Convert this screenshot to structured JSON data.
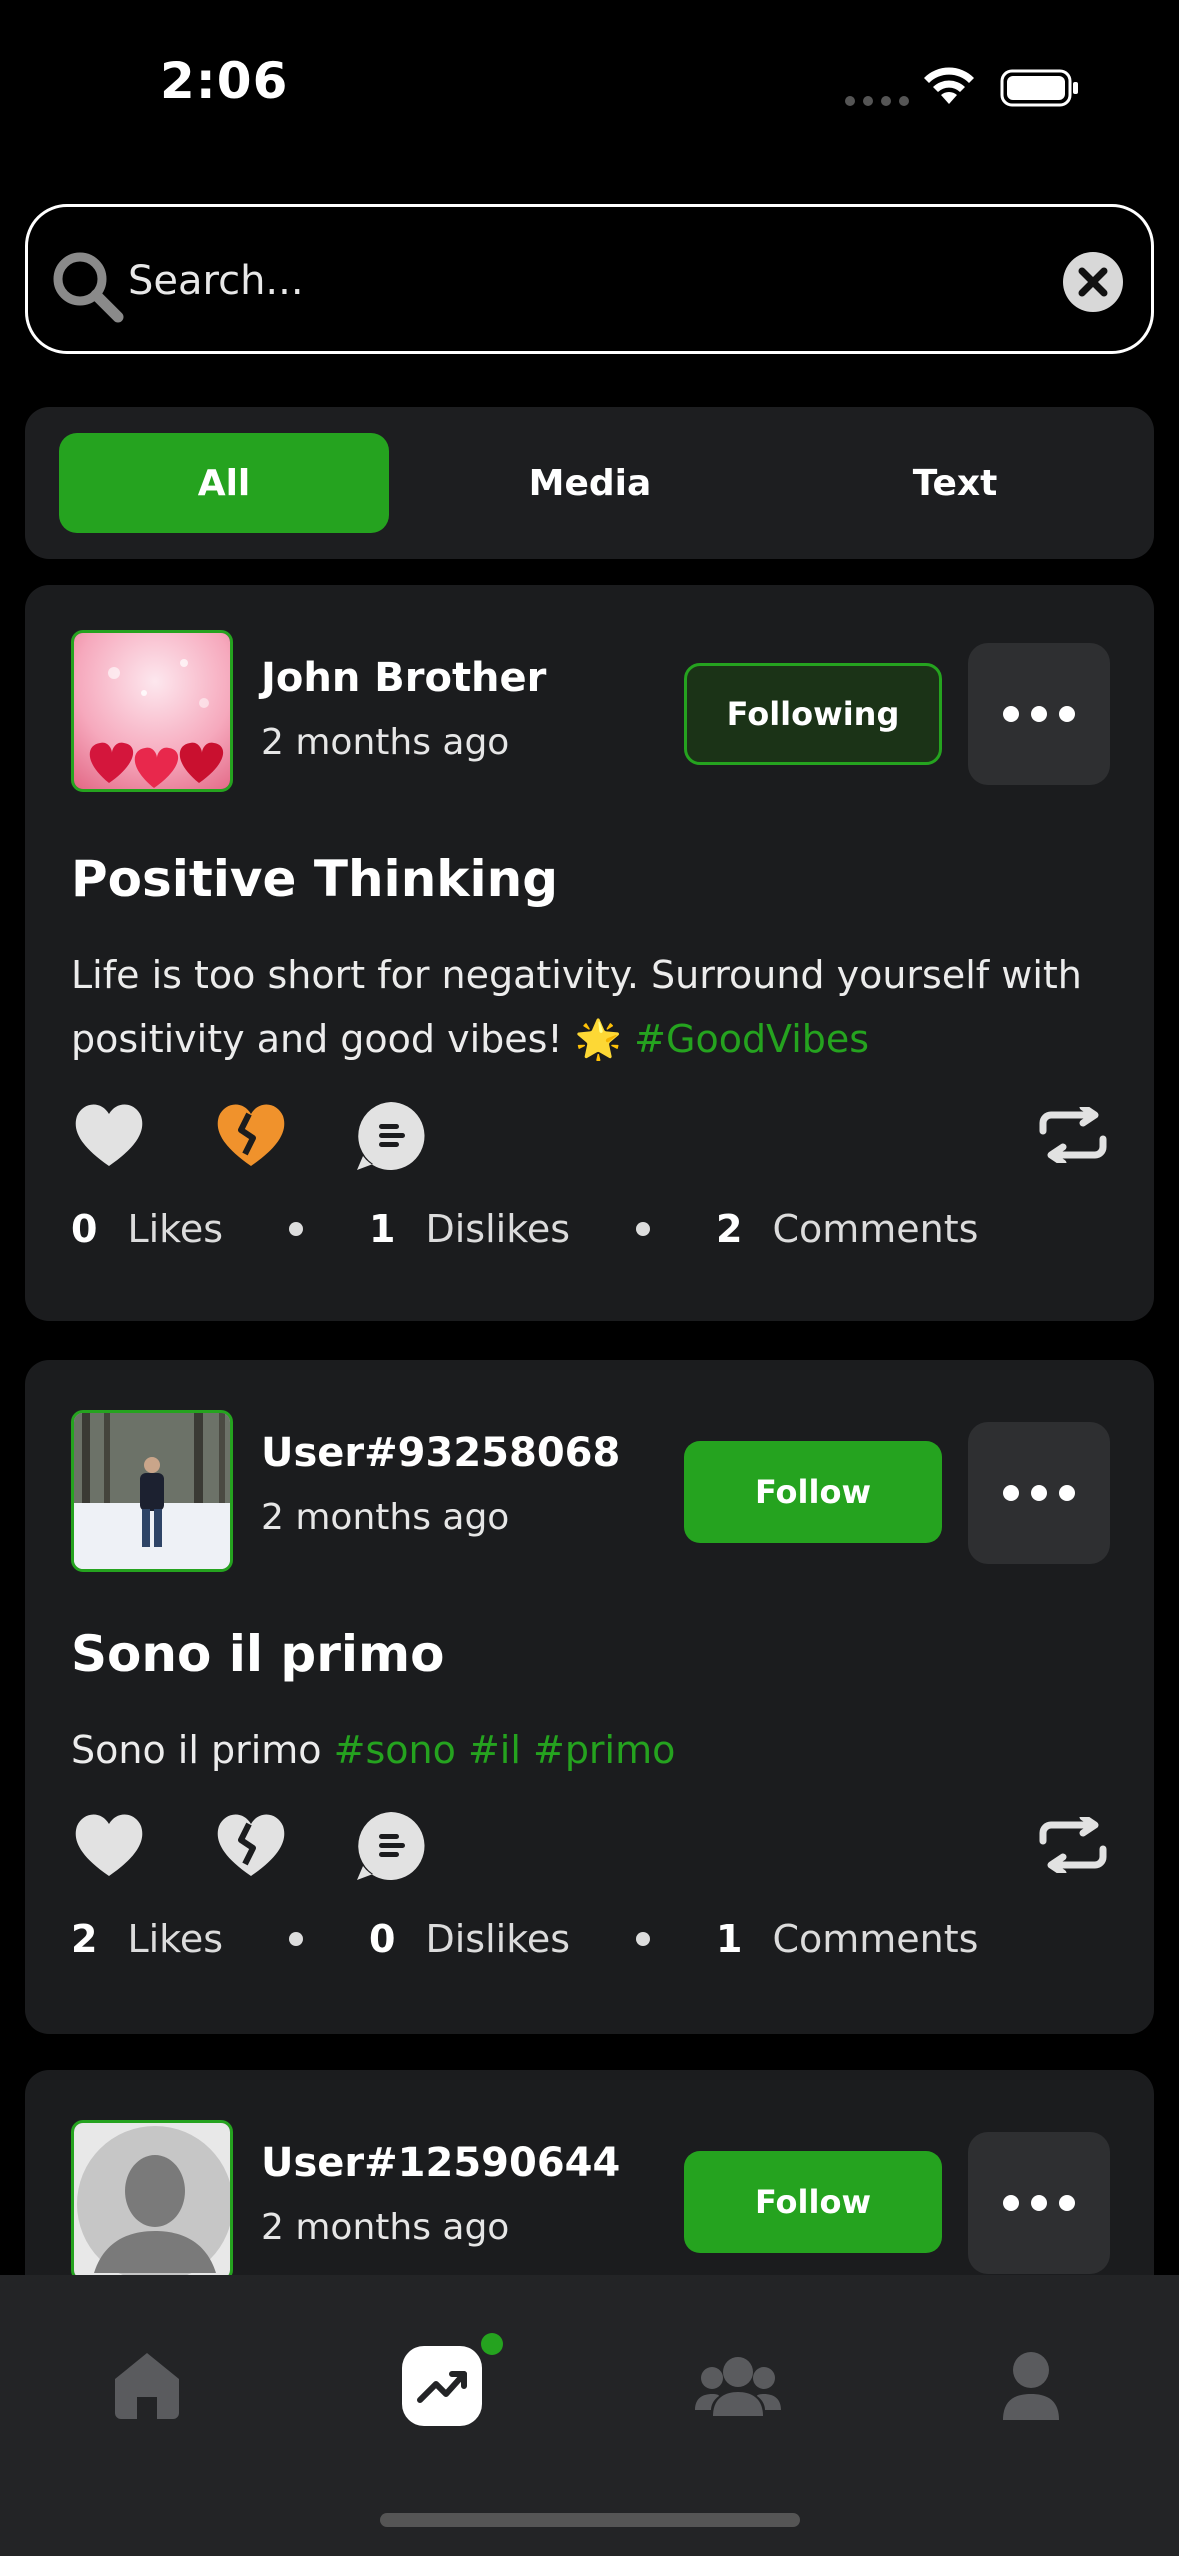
{
  "status_bar": {
    "time": "2:06"
  },
  "search": {
    "placeholder": "Search..."
  },
  "tabs": [
    {
      "label": "All",
      "active": true
    },
    {
      "label": "Media",
      "active": false
    },
    {
      "label": "Text",
      "active": false
    }
  ],
  "posts": [
    {
      "username": "John Brother",
      "timestamp": "2 months ago",
      "follow_label": "Following",
      "title": "Positive Thinking",
      "body": "Life is too short for negativity. Surround yourself with positivity and good vibes! 🌟",
      "hashtags": "#GoodVibes",
      "likes": "0",
      "likes_label": "Likes",
      "dislikes": "1",
      "dislikes_label": "Dislikes",
      "comments": "2",
      "comments_label": "Comments",
      "disliked": true
    },
    {
      "username": "User#93258068",
      "timestamp": "2 months ago",
      "follow_label": "Follow",
      "title": "Sono il primo",
      "body": "Sono il primo",
      "hashtags": "#sono #il #primo",
      "likes": "2",
      "likes_label": "Likes",
      "dislikes": "0",
      "dislikes_label": "Dislikes",
      "comments": "1",
      "comments_label": "Comments",
      "disliked": false
    },
    {
      "username": "User#12590644",
      "timestamp": "2 months ago",
      "follow_label": "Follow"
    }
  ],
  "icons": {
    "search": "search-icon",
    "clear": "clear-icon",
    "like": "heart-icon",
    "dislike": "broken-heart-icon",
    "comment": "comment-icon",
    "repost": "repost-icon",
    "more": "more-icon",
    "nav_home": "home-icon",
    "nav_trending": "trending-icon",
    "nav_community": "community-icon",
    "nav_profile": "profile-icon"
  },
  "colors": {
    "accent": "#25a31f",
    "dislike_active": "#f0922c",
    "background": "#000000",
    "card": "#1b1c1e"
  }
}
